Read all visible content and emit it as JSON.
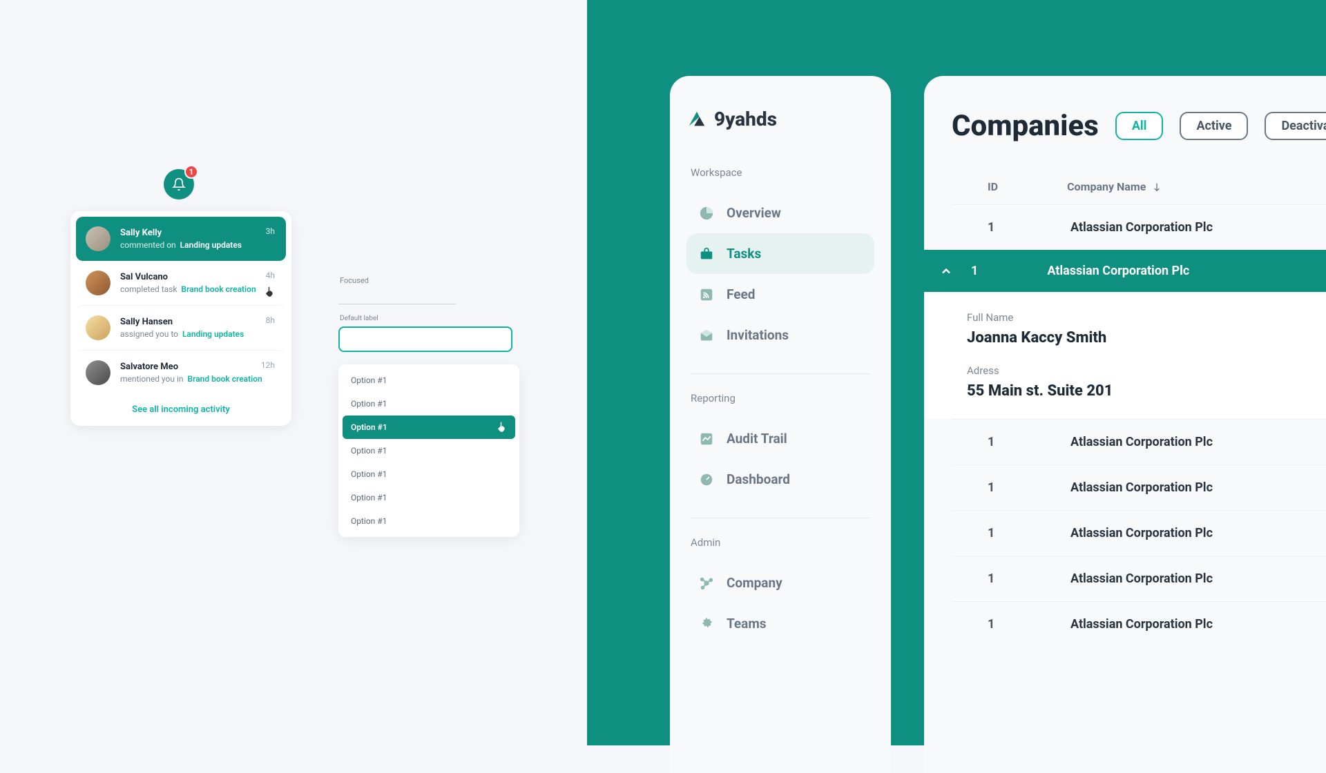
{
  "colors": {
    "brand": "#0f8f7f",
    "accent": "#0fb4a3",
    "danger": "#ef4444"
  },
  "bell": {
    "badge": "1"
  },
  "notifications": {
    "items": [
      {
        "name": "Sally Kelly",
        "action": "commented on",
        "target": "Landing updates",
        "time": "3h"
      },
      {
        "name": "Sal Vulcano",
        "action": "completed task",
        "target": "Brand book creation",
        "time": "4h"
      },
      {
        "name": "Sally Hansen",
        "action": "assigned you to",
        "target": "Landing updates",
        "time": "8h"
      },
      {
        "name": "Salvatore Meo",
        "action": "mentioned you in",
        "target": "Brand book creation",
        "time": "12h"
      }
    ],
    "see_all": "See all incoming activity"
  },
  "form": {
    "focused_label": "Focused",
    "default_label": "Default label",
    "options": [
      "Option #1",
      "Option #1",
      "Option #1",
      "Option #1",
      "Option #1",
      "Option #1",
      "Option #1"
    ],
    "selected_index": 2
  },
  "brand": {
    "name": "9yahds"
  },
  "sidebar": {
    "sections": {
      "workspace": {
        "label": "Workspace",
        "items": [
          {
            "key": "overview",
            "label": "Overview"
          },
          {
            "key": "tasks",
            "label": "Tasks"
          },
          {
            "key": "feed",
            "label": "Feed"
          },
          {
            "key": "invitations",
            "label": "Invitations"
          }
        ],
        "active_key": "tasks"
      },
      "reporting": {
        "label": "Reporting",
        "items": [
          {
            "key": "audit",
            "label": "Audit Trail"
          },
          {
            "key": "dashboard",
            "label": "Dashboard"
          }
        ]
      },
      "admin": {
        "label": "Admin",
        "items": [
          {
            "key": "company",
            "label": "Company"
          },
          {
            "key": "teams",
            "label": "Teams"
          }
        ]
      }
    }
  },
  "companies": {
    "title": "Companies",
    "filters": {
      "all": "All",
      "active": "Active",
      "deactivated": "Deactivated"
    },
    "columns": {
      "id": "ID",
      "name": "Company Name"
    },
    "rows": [
      {
        "id": "1",
        "name": "Atlassian Corporation Plc"
      },
      {
        "id": "1",
        "name": "Atlassian Corporation Plc"
      },
      {
        "id": "1",
        "name": "Atlassian Corporation Plc"
      },
      {
        "id": "1",
        "name": "Atlassian Corporation Plc"
      },
      {
        "id": "1",
        "name": "Atlassian Corporation Plc"
      },
      {
        "id": "1",
        "name": "Atlassian Corporation Plc"
      },
      {
        "id": "1",
        "name": "Atlassian Corporation Plc"
      }
    ],
    "expanded_index": 1,
    "details": {
      "full_name_label": "Full Name",
      "full_name": "Joanna Kaccy Smith",
      "address_label": "Adress",
      "address": "55 Main st. Suite 201"
    }
  }
}
